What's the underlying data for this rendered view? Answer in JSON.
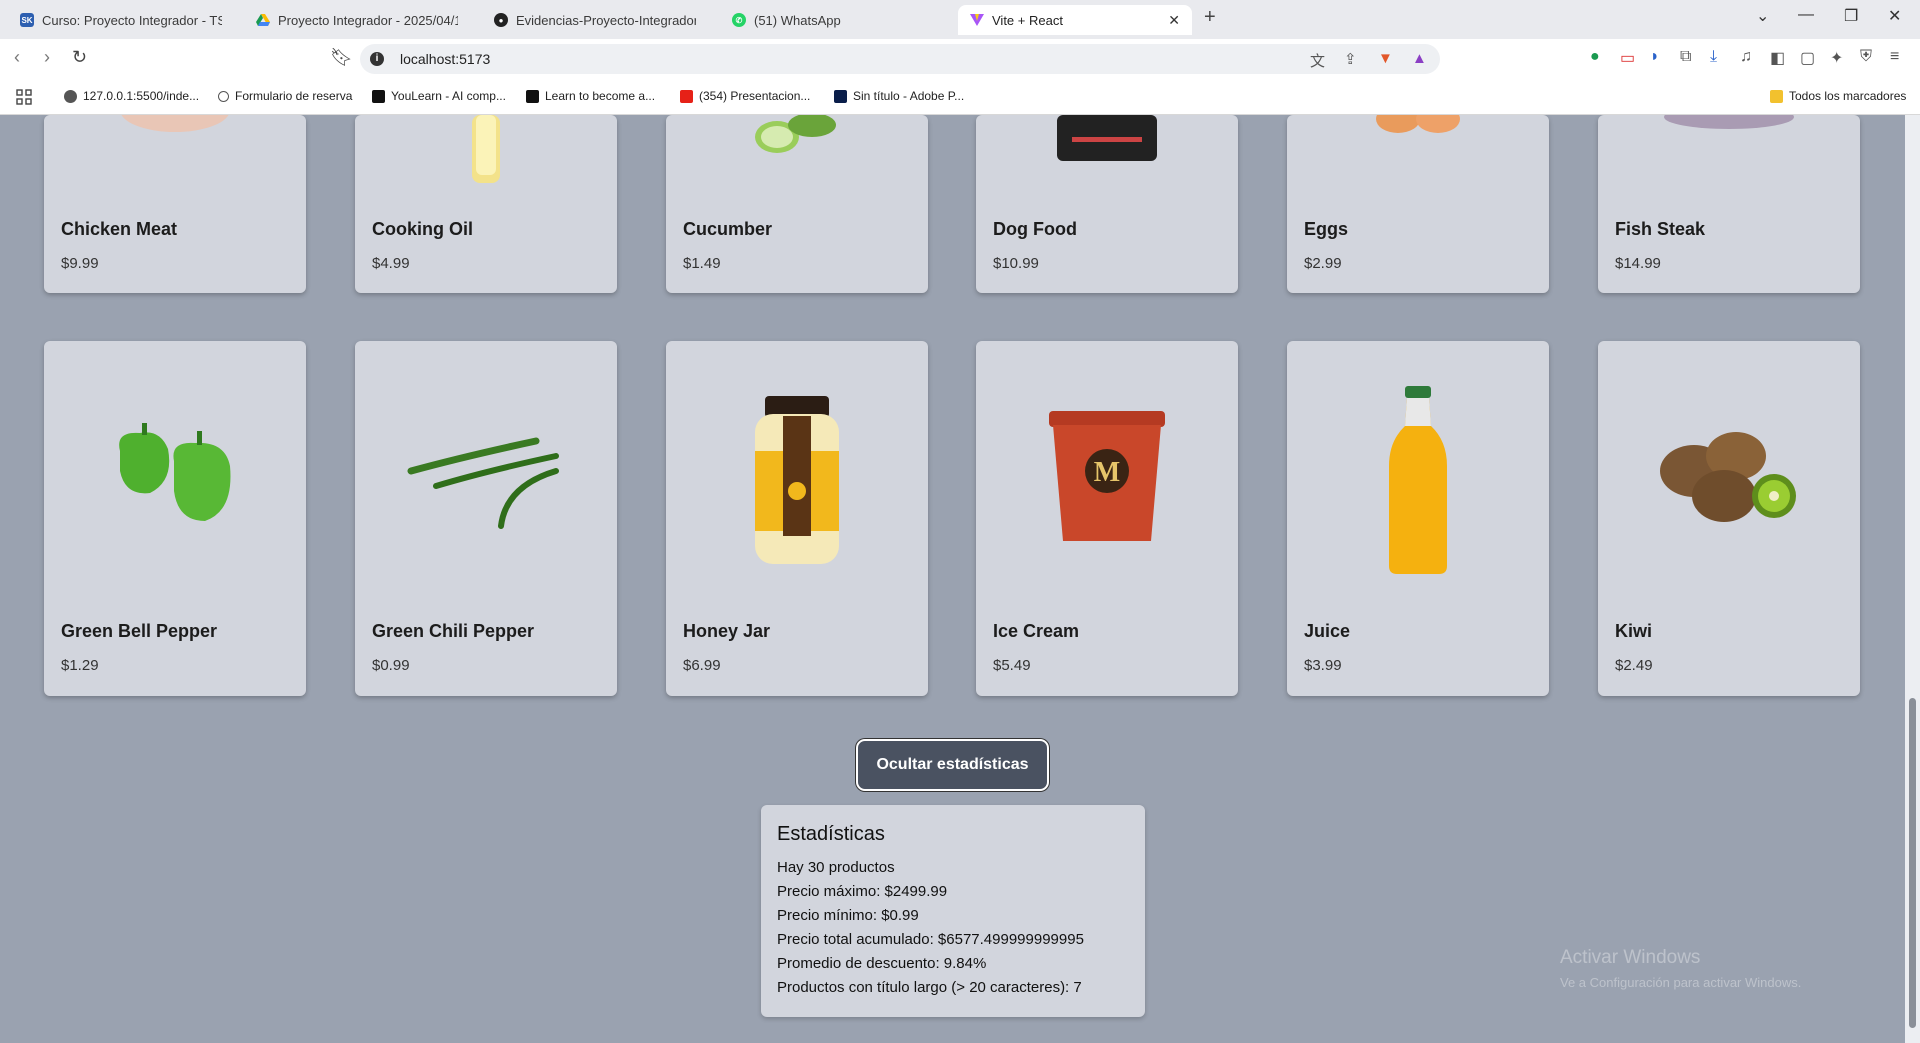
{
  "browser": {
    "tabs": [
      {
        "label": "Curso: Proyecto Integrador - TSCDIA",
        "active": false,
        "icon": "school-favicon"
      },
      {
        "label": "Proyecto Integrador - 2025/04/10 1",
        "active": false,
        "icon": "google-drive-favicon"
      },
      {
        "label": "Evidencias-Proyecto-Integrador/pro",
        "active": false,
        "icon": "github-favicon"
      },
      {
        "label": "(51) WhatsApp",
        "active": false,
        "icon": "whatsapp-favicon"
      },
      {
        "label": "Vite + React",
        "active": true,
        "icon": "vite-favicon"
      }
    ],
    "url": "localhost:5173",
    "bookmarks": [
      {
        "label": "127.0.0.1:5500/inde..."
      },
      {
        "label": "Formulario de reserva"
      },
      {
        "label": "YouLearn - AI comp..."
      },
      {
        "label": "Learn to become a..."
      },
      {
        "label": "(354) Presentacion..."
      },
      {
        "label": "Sin título - Adobe P..."
      }
    ],
    "all_bookmarks": "Todos los marcadores"
  },
  "products_row1": [
    {
      "name": "Chicken Meat",
      "price": "$9.99"
    },
    {
      "name": "Cooking Oil",
      "price": "$4.99"
    },
    {
      "name": "Cucumber",
      "price": "$1.49"
    },
    {
      "name": "Dog Food",
      "price": "$10.99"
    },
    {
      "name": "Eggs",
      "price": "$2.99"
    },
    {
      "name": "Fish Steak",
      "price": "$14.99"
    }
  ],
  "products_row2": [
    {
      "name": "Green Bell Pepper",
      "price": "$1.29"
    },
    {
      "name": "Green Chili Pepper",
      "price": "$0.99"
    },
    {
      "name": "Honey Jar",
      "price": "$6.99"
    },
    {
      "name": "Ice Cream",
      "price": "$5.49"
    },
    {
      "name": "Juice",
      "price": "$3.99"
    },
    {
      "name": "Kiwi",
      "price": "$2.49"
    }
  ],
  "toggle_button": "Ocultar estadísticas",
  "stats": {
    "title": "Estadísticas",
    "lines": [
      "Hay 30 productos",
      "Precio máximo: $2499.99",
      "Precio mínimo: $0.99",
      "Precio total acumulado: $6577.499999999995",
      "Promedio de descuento: 9.84%",
      "Productos con título largo (> 20 caracteres): 7"
    ]
  },
  "watermark": {
    "line1": "Activar Windows",
    "line2": "Ve a Configuración para activar Windows."
  }
}
